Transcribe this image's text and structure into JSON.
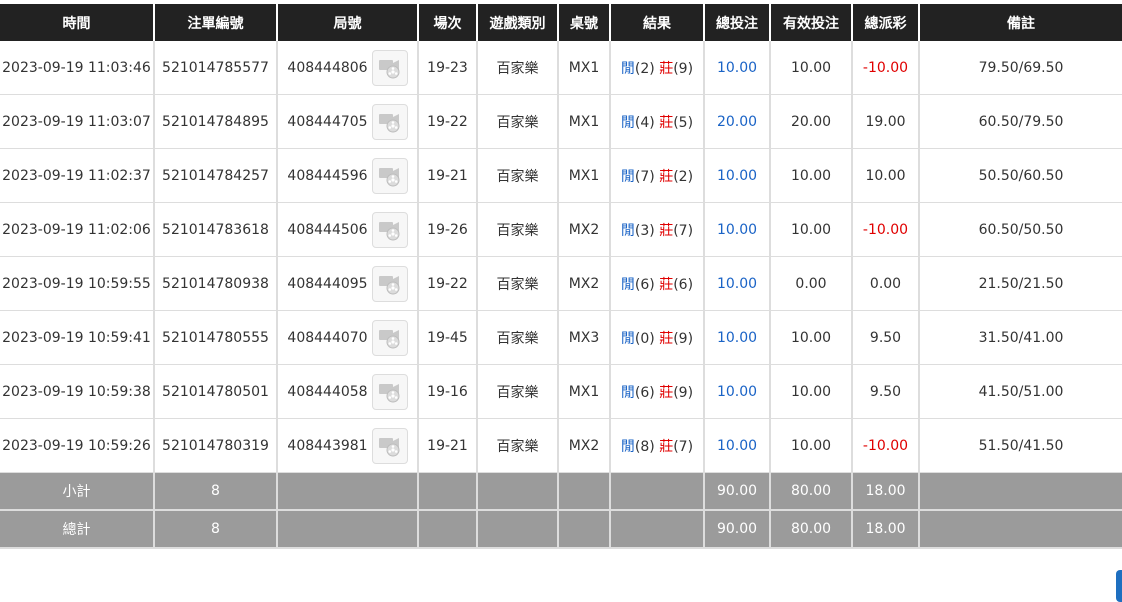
{
  "headers": [
    "時間",
    "注單編號",
    "局號",
    "場次",
    "遊戲類別",
    "桌號",
    "結果",
    "總投注",
    "有效投注",
    "總派彩",
    "備註"
  ],
  "player_label": "閒",
  "banker_label": "莊",
  "rows": [
    {
      "time": "2023-09-19 11:03:46",
      "bet_id": "521014785577",
      "round_id": "408444806",
      "session": "19-23",
      "game": "百家樂",
      "table": "MX1",
      "p": "(2)",
      "b": "(9)",
      "total": "10.00",
      "valid": "10.00",
      "payout": "-10.00",
      "payout_color": "red",
      "note": "79.50/69.50"
    },
    {
      "time": "2023-09-19 11:03:07",
      "bet_id": "521014784895",
      "round_id": "408444705",
      "session": "19-22",
      "game": "百家樂",
      "table": "MX1",
      "p": "(4)",
      "b": "(5)",
      "total": "20.00",
      "valid": "20.00",
      "payout": "19.00",
      "payout_color": "normal",
      "note": "60.50/79.50"
    },
    {
      "time": "2023-09-19 11:02:37",
      "bet_id": "521014784257",
      "round_id": "408444596",
      "session": "19-21",
      "game": "百家樂",
      "table": "MX1",
      "p": "(7)",
      "b": "(2)",
      "total": "10.00",
      "valid": "10.00",
      "payout": "10.00",
      "payout_color": "normal",
      "note": "50.50/60.50"
    },
    {
      "time": "2023-09-19 11:02:06",
      "bet_id": "521014783618",
      "round_id": "408444506",
      "session": "19-26",
      "game": "百家樂",
      "table": "MX2",
      "p": "(3)",
      "b": "(7)",
      "total": "10.00",
      "valid": "10.00",
      "payout": "-10.00",
      "payout_color": "red",
      "note": "60.50/50.50"
    },
    {
      "time": "2023-09-19 10:59:55",
      "bet_id": "521014780938",
      "round_id": "408444095",
      "session": "19-22",
      "game": "百家樂",
      "table": "MX2",
      "p": "(6)",
      "b": "(6)",
      "total": "10.00",
      "valid": "0.00",
      "payout": "0.00",
      "payout_color": "normal",
      "note": "21.50/21.50"
    },
    {
      "time": "2023-09-19 10:59:41",
      "bet_id": "521014780555",
      "round_id": "408444070",
      "session": "19-45",
      "game": "百家樂",
      "table": "MX3",
      "p": "(0)",
      "b": "(9)",
      "total": "10.00",
      "valid": "10.00",
      "payout": "9.50",
      "payout_color": "normal",
      "note": "31.50/41.00"
    },
    {
      "time": "2023-09-19 10:59:38",
      "bet_id": "521014780501",
      "round_id": "408444058",
      "session": "19-16",
      "game": "百家樂",
      "table": "MX1",
      "p": "(6)",
      "b": "(9)",
      "total": "10.00",
      "valid": "10.00",
      "payout": "9.50",
      "payout_color": "normal",
      "note": "41.50/51.00"
    },
    {
      "time": "2023-09-19 10:59:26",
      "bet_id": "521014780319",
      "round_id": "408443981",
      "session": "19-21",
      "game": "百家樂",
      "table": "MX2",
      "p": "(8)",
      "b": "(7)",
      "total": "10.00",
      "valid": "10.00",
      "payout": "-10.00",
      "payout_color": "red",
      "note": "51.50/41.50"
    }
  ],
  "subtotal": {
    "label": "小計",
    "count": "8",
    "total": "90.00",
    "valid": "80.00",
    "payout": "18.00"
  },
  "grandtotal": {
    "label": "總計",
    "count": "8",
    "total": "90.00",
    "valid": "80.00",
    "payout": "18.00"
  },
  "icons": {
    "replay": "video-replay-icon"
  },
  "colors": {
    "header_bg": "#222222",
    "summary_bg": "#9b9b9b",
    "blue": "#1a63c6",
    "red": "#e00000"
  }
}
